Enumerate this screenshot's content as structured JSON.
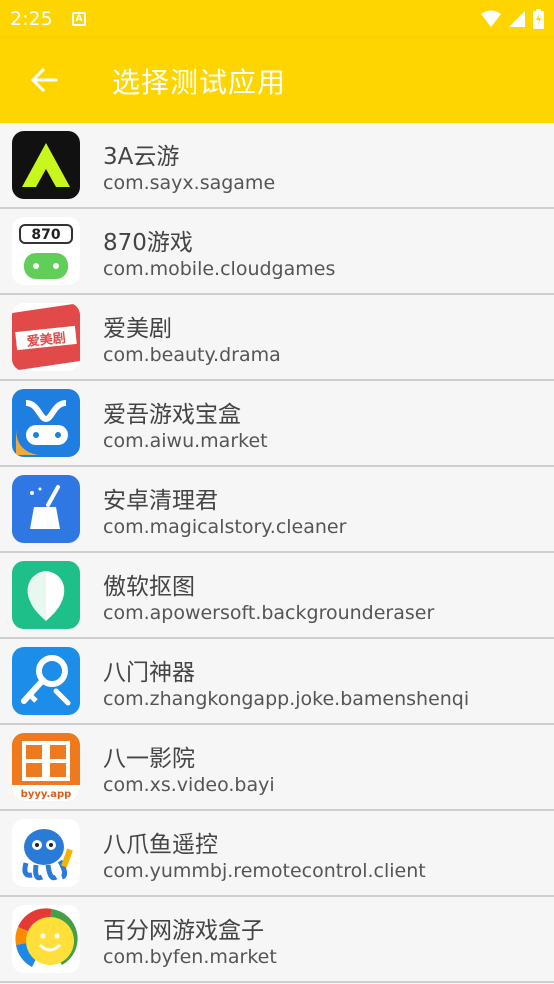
{
  "status": {
    "time": "2:25"
  },
  "appbar": {
    "title": "选择测试应用"
  },
  "apps": [
    {
      "name": "3A云游",
      "package": "com.sayx.sagame",
      "icon": "3a-cloud-game-icon"
    },
    {
      "name": "870游戏",
      "package": "com.mobile.cloudgames",
      "icon": "870-game-icon",
      "icon_text": "870"
    },
    {
      "name": "爱美剧",
      "package": "com.beauty.drama",
      "icon": "aimeiju-icon",
      "icon_text": "爱美剧"
    },
    {
      "name": "爱吾游戏宝盒",
      "package": "com.aiwu.market",
      "icon": "aiwu-game-box-icon"
    },
    {
      "name": "安卓清理君",
      "package": "com.magicalstory.cleaner",
      "icon": "cleaner-broom-icon"
    },
    {
      "name": "傲软抠图",
      "package": "com.apowersoft.backgrounderaser",
      "icon": "background-eraser-icon"
    },
    {
      "name": "八门神器",
      "package": "com.zhangkongapp.joke.bamenshenqi",
      "icon": "key-wrench-icon"
    },
    {
      "name": "八一影院",
      "package": "com.xs.video.bayi",
      "icon": "film-strip-icon",
      "icon_text": "byyy.app"
    },
    {
      "name": "八爪鱼遥控",
      "package": "com.yummbj.remotecontrol.client",
      "icon": "octopus-icon"
    },
    {
      "name": "百分网游戏盒子",
      "package": "com.byfen.market",
      "icon": "smiley-icon"
    }
  ]
}
